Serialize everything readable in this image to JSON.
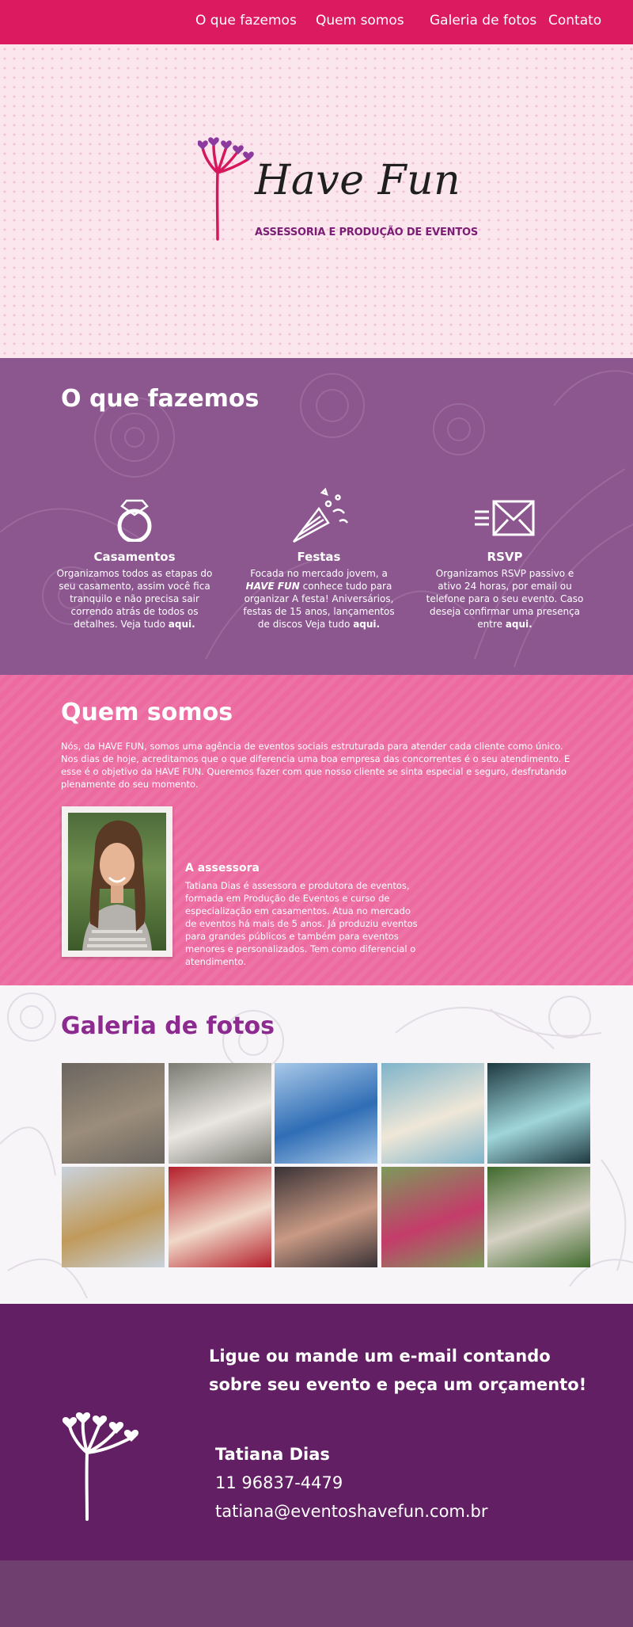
{
  "nav": {
    "items": [
      "O que fazemos",
      "Quem somos",
      "Galeria de fotos",
      "Contato"
    ]
  },
  "logo": {
    "title": "Have Fun",
    "tagline": "ASSESSORIA E PRODUÇÃO DE EVENTOS",
    "icon": "dandelion-hearts-icon"
  },
  "services": {
    "title": "O que fazemos",
    "items": [
      {
        "icon": "ring-icon",
        "title": "Casamentos",
        "text_1": "Organizamos todos as etapas do seu casamento, assim você fica tranquilo e não precisa sair correndo atrás de todos os detalhes.  Veja tudo ",
        "link": "aqui."
      },
      {
        "icon": "party-cone-icon",
        "title": "Festas",
        "text_1": "Focada no mercado jovem, a ",
        "text_emphasis": "HAVE FUN",
        "text_2": " conhece tudo para organizar A festa! Aniversários, festas de 15 anos, lançamentos de discos  Veja tudo ",
        "link": "aqui."
      },
      {
        "icon": "envelope-icon",
        "title": "RSVP",
        "text_1": "Organizamos RSVP passivo e ativo 24 horas, por email ou telefone para o seu evento. Caso deseja confirmar uma presença entre ",
        "link": "aqui."
      }
    ]
  },
  "about": {
    "title": "Quem somos",
    "text": "Nós, da HAVE FUN, somos uma agência de eventos sociais estruturada para atender cada cliente como único. Nos dias de hoje, acreditamos que o que diferencia uma boa empresa das concorrentes é o seu atendimento. E esse é o objetivo da HAVE FUN. Queremos fazer com que nosso cliente se sinta especial e seguro, desfrutando plenamente do seu momento.",
    "assessora_title": "A assessora",
    "assessora_text": "Tatiana Dias é assessora e produtora de eventos, formada em Produção de Eventos e curso de especialização em casamentos. Atua no mercado de eventos há mais de 5 anos. Já produziu eventos para grandes públicos e também para eventos menores e personalizados. Tem como diferencial o atendimento."
  },
  "gallery": {
    "title": "Galeria de fotos",
    "photos": [
      {
        "name": "photo-groomsmen-shoes",
        "bg": "#6b6560",
        "accent": "#9b8d7a"
      },
      {
        "name": "photo-bride-and-groom",
        "bg": "#7a7b73",
        "accent": "#e9e6e0"
      },
      {
        "name": "photo-blue-balloons",
        "bg": "#a9c9e8",
        "accent": "#2f6db5"
      },
      {
        "name": "photo-bride-dress-beach",
        "bg": "#7fb4c9",
        "accent": "#efe7d8"
      },
      {
        "name": "photo-dj-lights",
        "bg": "#1d3940",
        "accent": "#9fd6da"
      },
      {
        "name": "photo-wedding-rings",
        "bg": "#c9d2dc",
        "accent": "#c09a5b"
      },
      {
        "name": "photo-champagne-toast",
        "bg": "#b41f2a",
        "accent": "#f0d8c8"
      },
      {
        "name": "photo-friends-selfie",
        "bg": "#3a3236",
        "accent": "#c99a84"
      },
      {
        "name": "photo-flower-arrangement",
        "bg": "#7c9a5b",
        "accent": "#c43c6a"
      },
      {
        "name": "photo-outdoor-ceremony",
        "bg": "#3f6a2c",
        "accent": "#d5d0c3"
      }
    ]
  },
  "contact": {
    "cta": "Ligue ou mande um e-mail contando sobre seu evento e peça um orçamento!",
    "name": "Tatiana Dias",
    "phone": "11 96837-4479",
    "email": "tatiana@eventoshavefun.com.br"
  },
  "colors": {
    "nav": "#dc1a5f",
    "services_bg": "#8c568f",
    "about_bg": "#ec6aa0",
    "gallery_title": "#8c2a8f",
    "contact_bg": "#621f63",
    "footer_bg": "#6e3f6f"
  }
}
